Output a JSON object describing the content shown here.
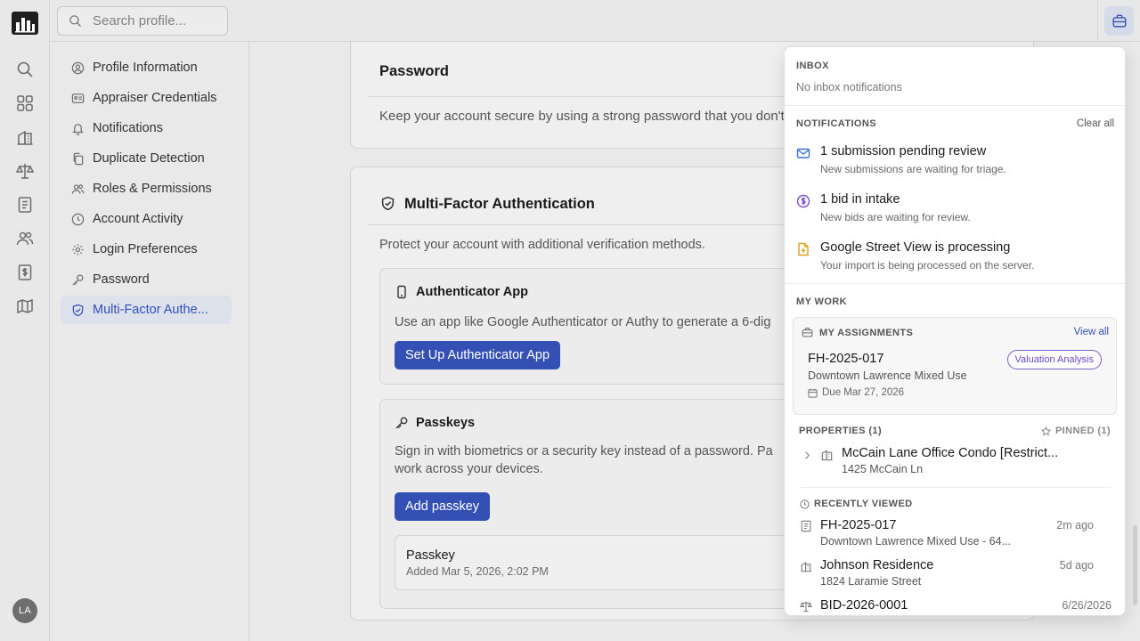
{
  "search": {
    "placeholder": "Search profile..."
  },
  "rail": {
    "avatar_initials": "LA"
  },
  "subnav": {
    "items": [
      {
        "label": "Profile Information"
      },
      {
        "label": "Appraiser Credentials"
      },
      {
        "label": "Notifications"
      },
      {
        "label": "Duplicate Detection"
      },
      {
        "label": "Roles & Permissions"
      },
      {
        "label": "Account Activity"
      },
      {
        "label": "Login Preferences"
      },
      {
        "label": "Password"
      },
      {
        "label": "Multi-Factor Authentication",
        "display": "Multi-Factor Authe...",
        "active": true
      }
    ]
  },
  "password_card": {
    "title": "Password",
    "description": "Keep your account secure by using a strong password that you don't"
  },
  "mfa_card": {
    "title": "Multi-Factor Authentication",
    "description": "Protect your account with additional verification methods.",
    "authenticator": {
      "title": "Authenticator App",
      "description": "Use an app like Google Authenticator or Authy to generate a 6-dig",
      "button": "Set Up Authenticator App"
    },
    "passkeys": {
      "title": "Passkeys",
      "description_line1": "Sign in with biometrics or a security key instead of a password. Pa",
      "description_line2": "work across your devices.",
      "button": "Add passkey",
      "entry": {
        "name": "Passkey",
        "added": "Added Mar 5, 2026, 2:02 PM"
      }
    }
  },
  "popover": {
    "inbox": {
      "heading": "INBOX",
      "empty": "No inbox notifications"
    },
    "notifications": {
      "heading": "NOTIFICATIONS",
      "clear_label": "Clear all",
      "items": [
        {
          "icon": "mail-icon",
          "title": "1 submission pending review",
          "desc": "New submissions are waiting for triage.",
          "color": "#3b6fd6"
        },
        {
          "icon": "dollar-icon",
          "title": "1 bid in intake",
          "desc": "New bids are waiting for review.",
          "color": "#7b4fd0"
        },
        {
          "icon": "file-upload-icon",
          "title": "Google Street View is processing",
          "desc": "Your import is being processed on the server.",
          "color": "#e0a020"
        }
      ]
    },
    "my_work": {
      "heading": "MY WORK",
      "assignments": {
        "heading": "MY ASSIGNMENTS",
        "view_all": "View all",
        "item": {
          "id": "FH-2025-017",
          "name": "Downtown Lawrence Mixed Use",
          "due": "Due Mar 27, 2026",
          "badge": "Valuation Analysis"
        }
      },
      "properties": {
        "heading": "PROPERTIES (1)",
        "pinned": "PINNED (1)",
        "item": {
          "title": "McCain Lane Office Condo [Restrict...",
          "address": "1425 McCain Ln"
        }
      },
      "recently_viewed": {
        "heading": "RECENTLY VIEWED",
        "items": [
          {
            "icon": "file-list-icon",
            "title": "FH-2025-017",
            "sub": "Downtown Lawrence Mixed Use - 64...",
            "time": "2m ago"
          },
          {
            "icon": "building-icon",
            "title": "Johnson Residence",
            "sub": "1824 Laramie Street",
            "time": "5d ago"
          },
          {
            "icon": "scale-icon",
            "title": "BID-2026-0001",
            "sub": "",
            "time": "6/26/2026"
          }
        ]
      }
    }
  },
  "colors": {
    "accent": "#3550b5",
    "active_nav_bg": "#dde1ec",
    "badge": "#6a46c4"
  }
}
